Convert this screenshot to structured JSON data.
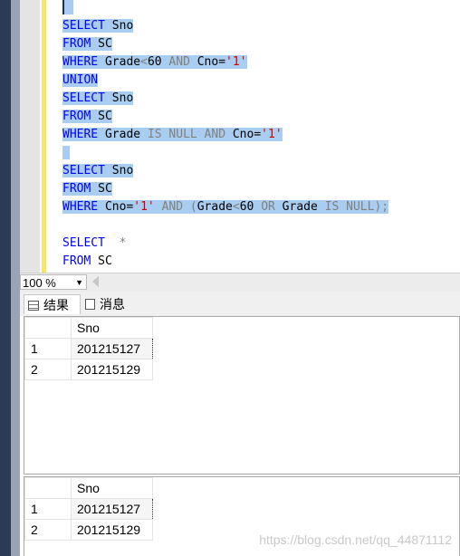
{
  "editor": {
    "lines": [
      {
        "parts": [
          [
            "kw",
            "SELECT"
          ],
          [
            "txt",
            " Sno"
          ]
        ],
        "selected": true
      },
      {
        "parts": [
          [
            "kw",
            "FROM"
          ],
          [
            "txt",
            " SC"
          ]
        ],
        "selected": true
      },
      {
        "parts": [
          [
            "kw",
            "WHERE"
          ],
          [
            "txt",
            " Grade"
          ],
          [
            "gray",
            "<"
          ],
          [
            "txt",
            "60 "
          ],
          [
            "gray",
            "AND"
          ],
          [
            "txt",
            " Cno="
          ],
          [
            "str",
            "'1'"
          ]
        ],
        "selected": true
      },
      {
        "parts": [
          [
            "kw",
            "UNION"
          ]
        ],
        "selected": true
      },
      {
        "parts": [
          [
            "kw",
            "SELECT"
          ],
          [
            "txt",
            " Sno"
          ]
        ],
        "selected": true
      },
      {
        "parts": [
          [
            "kw",
            "FROM"
          ],
          [
            "txt",
            " SC"
          ]
        ],
        "selected": true
      },
      {
        "parts": [
          [
            "kw",
            "WHERE"
          ],
          [
            "txt",
            " Grade "
          ],
          [
            "gray",
            "IS NULL AND"
          ],
          [
            "txt",
            " Cno="
          ],
          [
            "str",
            "'1'"
          ]
        ],
        "selected": true
      },
      {
        "parts": [
          [
            "txt",
            " "
          ]
        ],
        "selected": true
      },
      {
        "parts": [
          [
            "kw",
            "SELECT"
          ],
          [
            "txt",
            " Sno"
          ]
        ],
        "selected": true
      },
      {
        "parts": [
          [
            "kw",
            "FROM"
          ],
          [
            "txt",
            " SC"
          ]
        ],
        "selected": true
      },
      {
        "parts": [
          [
            "kw",
            "WHERE"
          ],
          [
            "txt",
            " Cno="
          ],
          [
            "str",
            "'1'"
          ],
          [
            "txt",
            " "
          ],
          [
            "gray",
            "AND"
          ],
          [
            "txt",
            " "
          ],
          [
            "gray",
            "("
          ],
          [
            "txt",
            "Grade"
          ],
          [
            "gray",
            "<"
          ],
          [
            "txt",
            "60 "
          ],
          [
            "gray",
            "OR"
          ],
          [
            "txt",
            " Grade "
          ],
          [
            "gray",
            "IS NULL);"
          ]
        ],
        "selected": true
      },
      {
        "parts": [
          [
            "txt",
            ""
          ]
        ],
        "selected": false
      },
      {
        "parts": [
          [
            "kw",
            "SELECT"
          ],
          [
            "txt",
            "  "
          ],
          [
            "gray",
            "*"
          ]
        ],
        "selected": false
      },
      {
        "parts": [
          [
            "kw",
            "FROM"
          ],
          [
            "txt",
            " SC"
          ]
        ],
        "selected": false
      }
    ]
  },
  "zoom": {
    "value": "100 %"
  },
  "tabs": {
    "results": "结果",
    "messages": "消息"
  },
  "results": [
    {
      "column": "Sno",
      "rows": [
        {
          "num": "1",
          "sno": "201215127"
        },
        {
          "num": "2",
          "sno": "201215129"
        }
      ]
    },
    {
      "column": "Sno",
      "rows": [
        {
          "num": "1",
          "sno": "201215127"
        },
        {
          "num": "2",
          "sno": "201215129"
        }
      ]
    }
  ],
  "watermark": "https://blog.csdn.net/qq_44871112"
}
